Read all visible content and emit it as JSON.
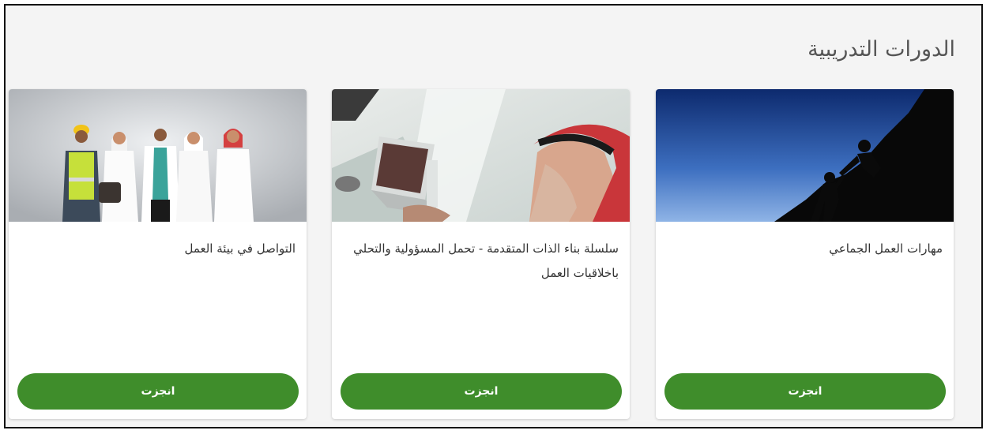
{
  "section": {
    "title": "الدورات التدريبية"
  },
  "colors": {
    "accent": "#3f8d2b",
    "page_bg": "#f4f4f4",
    "card_bg": "#ffffff"
  },
  "courses": [
    {
      "title": "مهارات العمل الجماعي",
      "image_icon": "team-climbing-image",
      "button_label": "انجزت"
    },
    {
      "title": "سلسلة بناء الذات المتقدمة - تحمل المسؤولية والتحلي باخلاقيات العمل",
      "image_icon": "man-laptop-image",
      "button_label": "انجزت"
    },
    {
      "title": "التواصل في بيئة العمل",
      "image_icon": "professionals-group-image",
      "button_label": "انجزت"
    }
  ]
}
